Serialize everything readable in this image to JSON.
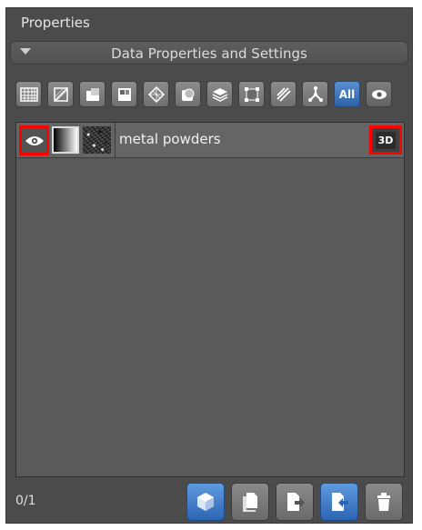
{
  "panel": {
    "title": "Properties"
  },
  "section": {
    "label": "Data Properties and Settings"
  },
  "toolbar": {
    "buttons": [
      {
        "icon": "grid-icon"
      },
      {
        "icon": "slice-icon"
      },
      {
        "icon": "region-icon"
      },
      {
        "icon": "multi-roi-icon"
      },
      {
        "icon": "mesh-icon"
      },
      {
        "icon": "shape-icon"
      },
      {
        "icon": "layers-icon"
      },
      {
        "icon": "bounds-icon"
      },
      {
        "icon": "ruler-icon"
      },
      {
        "icon": "graph-icon"
      }
    ],
    "all_label": "All",
    "visibility_icon": "eye-icon"
  },
  "list": {
    "items": [
      {
        "name": "metal powders",
        "badge": "3D",
        "visibility_icon": "eye-icon"
      }
    ]
  },
  "footer": {
    "count": "0/1",
    "buttons": [
      "cube-icon",
      "copy-icon",
      "export-icon",
      "import-icon",
      "trash-icon"
    ]
  },
  "colors": {
    "panel_bg": "#4b4b4b",
    "accent_blue": "#2c65b3",
    "highlight_red": "#ff0000"
  }
}
